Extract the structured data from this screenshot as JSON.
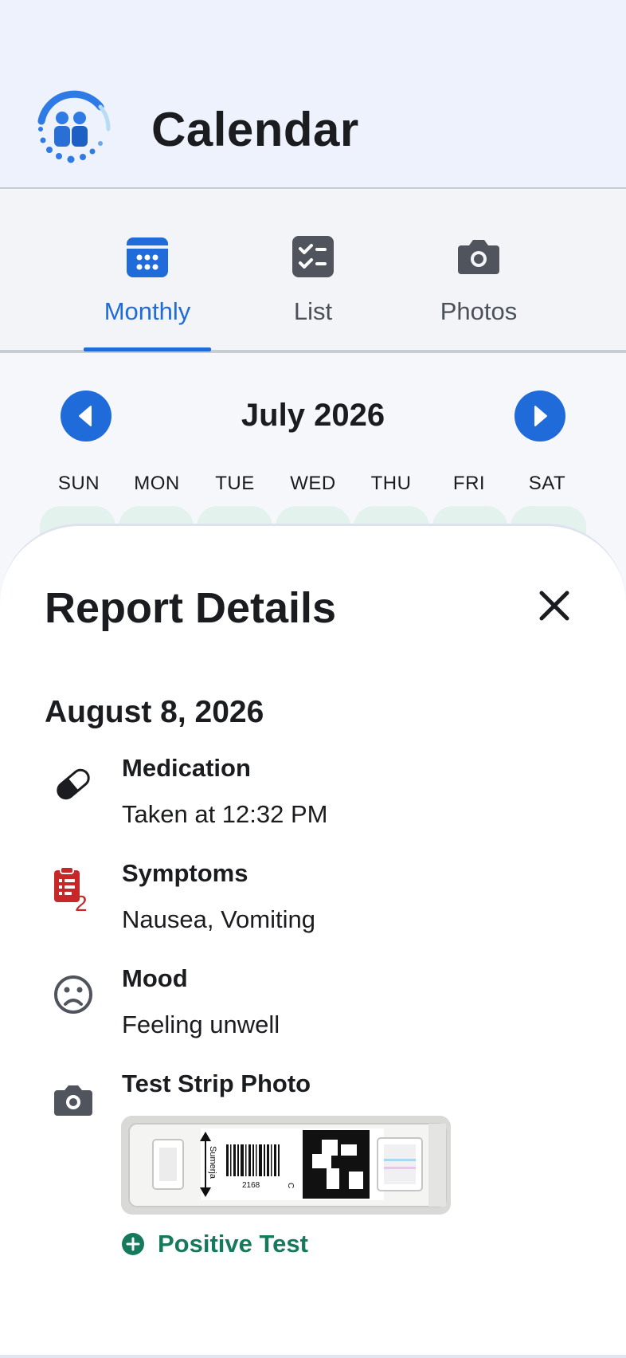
{
  "app": {
    "title": "Calendar"
  },
  "tabs": [
    {
      "label": "Monthly",
      "icon": "calendar-icon",
      "active": true
    },
    {
      "label": "List",
      "icon": "checklist-icon",
      "active": false
    },
    {
      "label": "Photos",
      "icon": "camera-icon",
      "active": false
    }
  ],
  "calendar": {
    "month_label": "July 2026",
    "weekdays": [
      "SUN",
      "MON",
      "TUE",
      "WED",
      "THU",
      "FRI",
      "SAT"
    ]
  },
  "report": {
    "title": "Report Details",
    "date": "August 8, 2026",
    "entries": [
      {
        "label": "Medication",
        "value": "Taken at 12:32 PM",
        "icon": "pill-icon"
      },
      {
        "label": "Symptoms",
        "value": "Nausea, Vomiting",
        "icon": "clipboard-icon",
        "count": "2"
      },
      {
        "label": "Mood",
        "value": "Feeling unwell",
        "icon": "sad-face-icon"
      },
      {
        "label": "Test Strip Photo",
        "icon": "camera-icon"
      }
    ],
    "photo": {
      "strip_name": "Sumerja",
      "barcode_number": "2168",
      "control_mark": "C"
    },
    "result_label": "Positive Test",
    "result_icon": "plus-circle-icon"
  },
  "colors": {
    "accent": "#1f6bd9",
    "positive": "#157a5b",
    "symptom_red": "#c62828",
    "header_bg": "#edf2fc"
  }
}
